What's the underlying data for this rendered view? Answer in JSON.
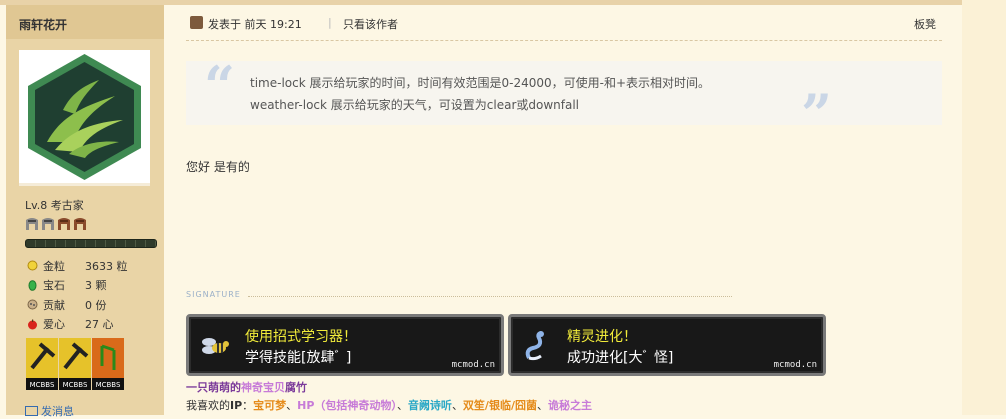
{
  "sidebar": {
    "username": "雨轩花开",
    "level": "Lv.8 考古家",
    "stats": [
      {
        "icon": "gold-coin-icon",
        "label": "金粒",
        "value": "3633 粒"
      },
      {
        "icon": "gem-icon",
        "label": "宝石",
        "value": "3 颗"
      },
      {
        "icon": "contribution-icon",
        "label": "贡献",
        "value": "0 份"
      },
      {
        "icon": "apple-heart-icon",
        "label": "爱心",
        "value": "27 心"
      }
    ],
    "medal_label": "MCBBS",
    "message_link": "发消息"
  },
  "post": {
    "posted_at": "发表于 前天 19:21",
    "separator": "|",
    "only_author": "只看该作者",
    "floor": "板凳",
    "quote_lines": [
      "time-lock 展示给玩家的时间，时间有效范围是0-24000，可使用-和+表示相对时间。",
      "weather-lock 展示给玩家的天气，可设置为clear或downfall"
    ],
    "reply": "您好 是有的"
  },
  "signature": {
    "label": "SIGNATURE",
    "achievements": [
      {
        "title": "使用招式学习器！",
        "subtitle": "学得技能[放肆ﾞ ]",
        "site": "mcmod.cn"
      },
      {
        "title": "精灵进化！",
        "subtitle": "成功进化[大ﾞ 怪]",
        "site": "mcmod.cn"
      }
    ],
    "line1": {
      "part1": "一只萌萌的",
      "part2": "神奇宝贝",
      "part3": "腐竹"
    },
    "line2": {
      "prefix": "我喜欢的",
      "ip": "IP",
      "colon": "：",
      "items": [
        {
          "text": "宝可梦",
          "color": "#e58b1a"
        },
        {
          "text": "、",
          "color": "#333333"
        },
        {
          "text": "HP（包括神奇动物）",
          "color": "#c77bd8"
        },
        {
          "text": "、",
          "color": "#333333"
        },
        {
          "text": "音阙诗听",
          "color": "#2aa8c6"
        },
        {
          "text": "、",
          "color": "#333333"
        },
        {
          "text": "双笙/银临/囧菌",
          "color": "#e58b1a"
        },
        {
          "text": "、",
          "color": "#333333"
        },
        {
          "text": "诡秘之主",
          "color": "#c77bd8"
        }
      ]
    }
  },
  "colors": {
    "sidebar_bg": "#e9d4a6",
    "page_bg": "#fdf7e4",
    "achievement_title": "#f2ec3a",
    "quote_mark": "#cad6e6"
  }
}
